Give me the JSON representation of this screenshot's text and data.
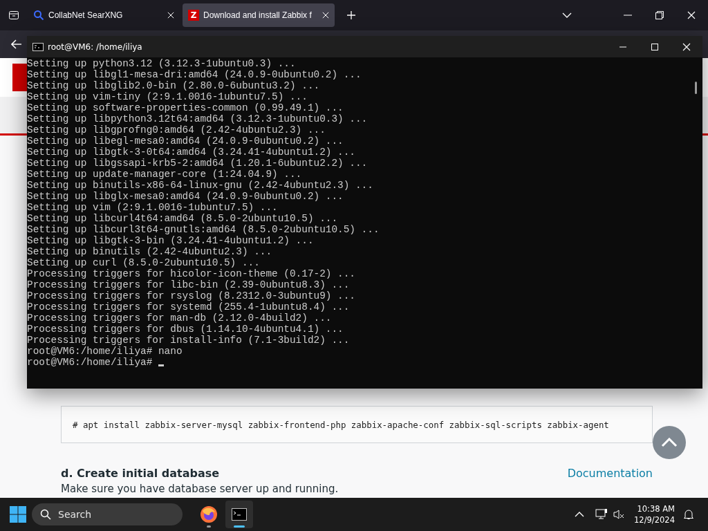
{
  "browser": {
    "tabs": [
      {
        "label": "CollabNet SearXNG",
        "selected": false
      },
      {
        "label": "Download and install Zabbix f",
        "selected": true,
        "favicon_letter": "Z"
      }
    ]
  },
  "page": {
    "command": "# apt install zabbix-server-mysql zabbix-frontend-php zabbix-apache-conf zabbix-sql-scripts zabbix-agent",
    "heading": "d. Create initial database",
    "link": "Documentation",
    "paragraph": "Make sure you have database server up and running."
  },
  "terminal": {
    "title": "root@VM6: /home/iliya",
    "lines": [
      "Setting up python3.12 (3.12.3-1ubuntu0.3) ...",
      "Setting up libgl1-mesa-dri:amd64 (24.0.9-0ubuntu0.2) ...",
      "Setting up libglib2.0-bin (2.80.0-6ubuntu3.2) ...",
      "Setting up vim-tiny (2:9.1.0016-1ubuntu7.5) ...",
      "Setting up software-properties-common (0.99.49.1) ...",
      "Setting up libpython3.12t64:amd64 (3.12.3-1ubuntu0.3) ...",
      "Setting up libgprofng0:amd64 (2.42-4ubuntu2.3) ...",
      "Setting up libegl-mesa0:amd64 (24.0.9-0ubuntu0.2) ...",
      "Setting up libgtk-3-0t64:amd64 (3.24.41-4ubuntu1.2) ...",
      "Setting up libgssapi-krb5-2:amd64 (1.20.1-6ubuntu2.2) ...",
      "Setting up update-manager-core (1:24.04.9) ...",
      "Setting up binutils-x86-64-linux-gnu (2.42-4ubuntu2.3) ...",
      "Setting up libglx-mesa0:amd64 (24.0.9-0ubuntu0.2) ...",
      "Setting up vim (2:9.1.0016-1ubuntu7.5) ...",
      "Setting up libcurl4t64:amd64 (8.5.0-2ubuntu10.5) ...",
      "Setting up libcurl3t64-gnutls:amd64 (8.5.0-2ubuntu10.5) ...",
      "Setting up libgtk-3-bin (3.24.41-4ubuntu1.2) ...",
      "Setting up binutils (2.42-4ubuntu2.3) ...",
      "Setting up curl (8.5.0-2ubuntu10.5) ...",
      "Processing triggers for hicolor-icon-theme (0.17-2) ...",
      "Processing triggers for libc-bin (2.39-0ubuntu8.3) ...",
      "Processing triggers for rsyslog (8.2312.0-3ubuntu9) ...",
      "Processing triggers for systemd (255.4-1ubuntu8.4) ...",
      "Processing triggers for man-db (2.12.0-4build2) ...",
      "Processing triggers for dbus (1.14.10-4ubuntu4.1) ...",
      "Processing triggers for install-info (7.1-3build2) ...",
      "root@VM6:/home/iliya# nano"
    ],
    "prompt": "root@VM6:/home/iliya#"
  },
  "taskbar": {
    "search_placeholder": "Search",
    "apps": [
      {
        "selected": false
      },
      {
        "selected": true
      }
    ],
    "time": "10:38 AM",
    "date": "12/9/2024"
  }
}
